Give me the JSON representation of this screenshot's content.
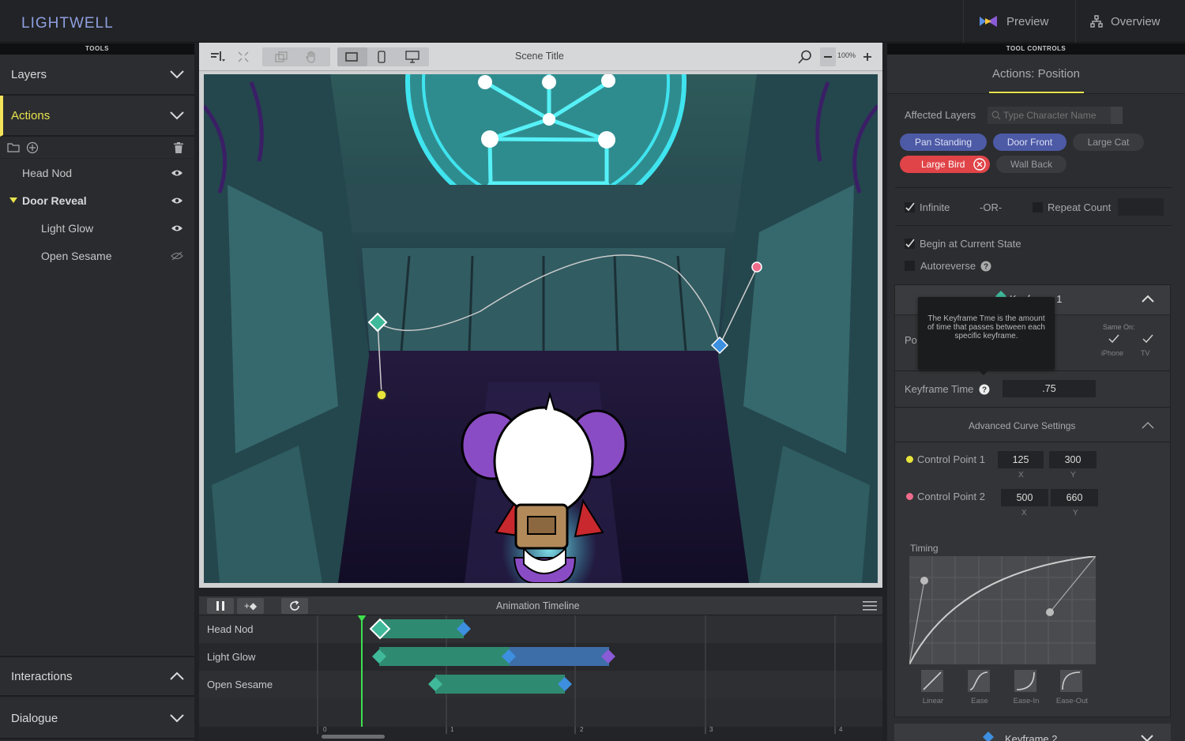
{
  "app": {
    "logo": "LIGHTWELL",
    "preview_label": "Preview",
    "overview_label": "Overview"
  },
  "left": {
    "header": "TOOLS",
    "sections": {
      "layers": "Layers",
      "actions": "Actions",
      "interactions": "Interactions",
      "dialogue": "Dialogue"
    },
    "actions": [
      {
        "label": "Head Nod",
        "level": 0,
        "visible": true
      },
      {
        "label": "Door Reveal",
        "level": 0,
        "visible": true,
        "expanded": true
      },
      {
        "label": "Light Glow",
        "level": 1,
        "visible": true
      },
      {
        "label": "Open Sesame",
        "level": 1,
        "visible": false
      }
    ]
  },
  "canvas": {
    "scene_title": "Scene Title",
    "zoom": "100%"
  },
  "timeline": {
    "title": "Animation Timeline",
    "add_keyframe_label": "+◆",
    "tracks": [
      "Head Nod",
      "Light Glow",
      "Open Sesame"
    ],
    "ticks": [
      "0",
      "1",
      "2",
      "3",
      "4"
    ]
  },
  "right": {
    "header": "TOOL CONTROLS",
    "title": "Actions: Position",
    "affected_layers_label": "Affected Layers",
    "search_placeholder": "Type Character Name",
    "layers": [
      {
        "label": "Pan Standing",
        "style": "active"
      },
      {
        "label": "Door Front",
        "style": "active"
      },
      {
        "label": "Large Cat",
        "style": "inactive"
      },
      {
        "label": "Large Bird",
        "style": "selected"
      },
      {
        "label": "Wall Back",
        "style": "inactive"
      }
    ],
    "infinite_label": "Infinite",
    "infinite_checked": true,
    "or_label": "-OR-",
    "repeat_count_label": "Repeat Count",
    "repeat_count_checked": false,
    "begin_current_label": "Begin at Current State",
    "begin_current_checked": true,
    "autoreverse_label": "Autoreverse",
    "autoreverse_checked": false,
    "keyframe1_title": "Keyframe 1",
    "tooltip": "The Keyframe Tme is the amount of time that passes between each specific keyframe.",
    "position_label_partial": "Po",
    "same_on_label": "Same On:",
    "same_on": [
      {
        "label": "iPhone",
        "checked": true
      },
      {
        "label": "TV",
        "checked": true
      }
    ],
    "keyframe_time_label": "Keyframe Time",
    "keyframe_time_value": ".75",
    "advanced_label": "Advanced Curve Settings",
    "cp1": {
      "label": "Control Point 1",
      "x": "125",
      "y": "300",
      "color": "#e8e43a"
    },
    "cp2": {
      "label": "Control Point 2",
      "x": "500",
      "y": "660",
      "color": "#f06c8c"
    },
    "x_label": "X",
    "y_label": "Y",
    "timing_label": "Timing",
    "presets": [
      "Linear",
      "Ease",
      "Ease-In",
      "Ease-Out"
    ],
    "keyframe2_title": "Keyframe 2"
  },
  "colors": {
    "accent_yellow": "#e8e34e",
    "chip_blue": "#4d5aa6",
    "chip_red": "#e04448",
    "track_green": "#2f8a72",
    "track_blue": "#3e6ea8"
  }
}
